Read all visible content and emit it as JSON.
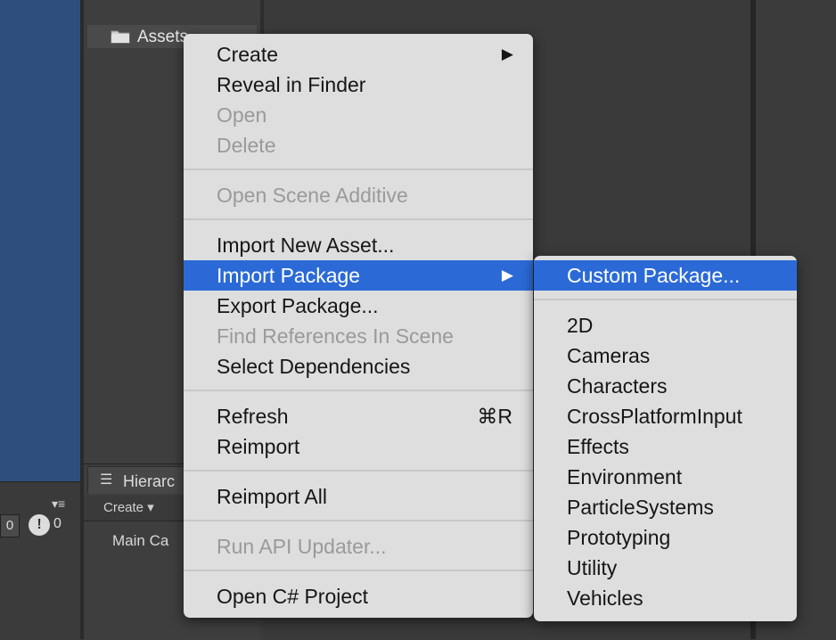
{
  "project": {
    "title": "Assets"
  },
  "console": {
    "log_count": "0",
    "warn_icon": "!",
    "warn_count": "0",
    "menu_icon": "▾≡"
  },
  "hierarchy": {
    "tab_icon": "☰",
    "title": "Hierarc",
    "create_label": "Create ▾",
    "items": [
      "Main Ca"
    ]
  },
  "context_menu": {
    "items": [
      {
        "label": "Create",
        "enabled": true,
        "submenu": true
      },
      {
        "label": "Reveal in Finder",
        "enabled": true
      },
      {
        "label": "Open",
        "enabled": false
      },
      {
        "label": "Delete",
        "enabled": false
      },
      {
        "label": "Open Scene Additive",
        "enabled": false
      },
      {
        "label": "Import New Asset...",
        "enabled": true
      },
      {
        "label": "Import Package",
        "enabled": true,
        "submenu": true,
        "highlighted": true
      },
      {
        "label": "Export Package...",
        "enabled": true
      },
      {
        "label": "Find References In Scene",
        "enabled": false
      },
      {
        "label": "Select Dependencies",
        "enabled": true
      },
      {
        "label": "Refresh",
        "enabled": true,
        "shortcut": "⌘R"
      },
      {
        "label": "Reimport",
        "enabled": true
      },
      {
        "label": "Reimport All",
        "enabled": true
      },
      {
        "label": "Run API Updater...",
        "enabled": false
      },
      {
        "label": "Open C# Project",
        "enabled": true
      }
    ],
    "arrow_glyph": "▶"
  },
  "import_package_submenu": {
    "items": [
      {
        "label": "Custom Package...",
        "highlighted": true
      },
      {
        "label": "2D"
      },
      {
        "label": "Cameras"
      },
      {
        "label": "Characters"
      },
      {
        "label": "CrossPlatformInput"
      },
      {
        "label": "Effects"
      },
      {
        "label": "Environment"
      },
      {
        "label": "ParticleSystems"
      },
      {
        "label": "Prototyping"
      },
      {
        "label": "Utility"
      },
      {
        "label": "Vehicles"
      }
    ]
  },
  "colors": {
    "highlight": "#2b6ad6",
    "menu_bg": "#dedede",
    "disabled_text": "#9a9a9a",
    "scene_blue": "#2e4e7e"
  }
}
